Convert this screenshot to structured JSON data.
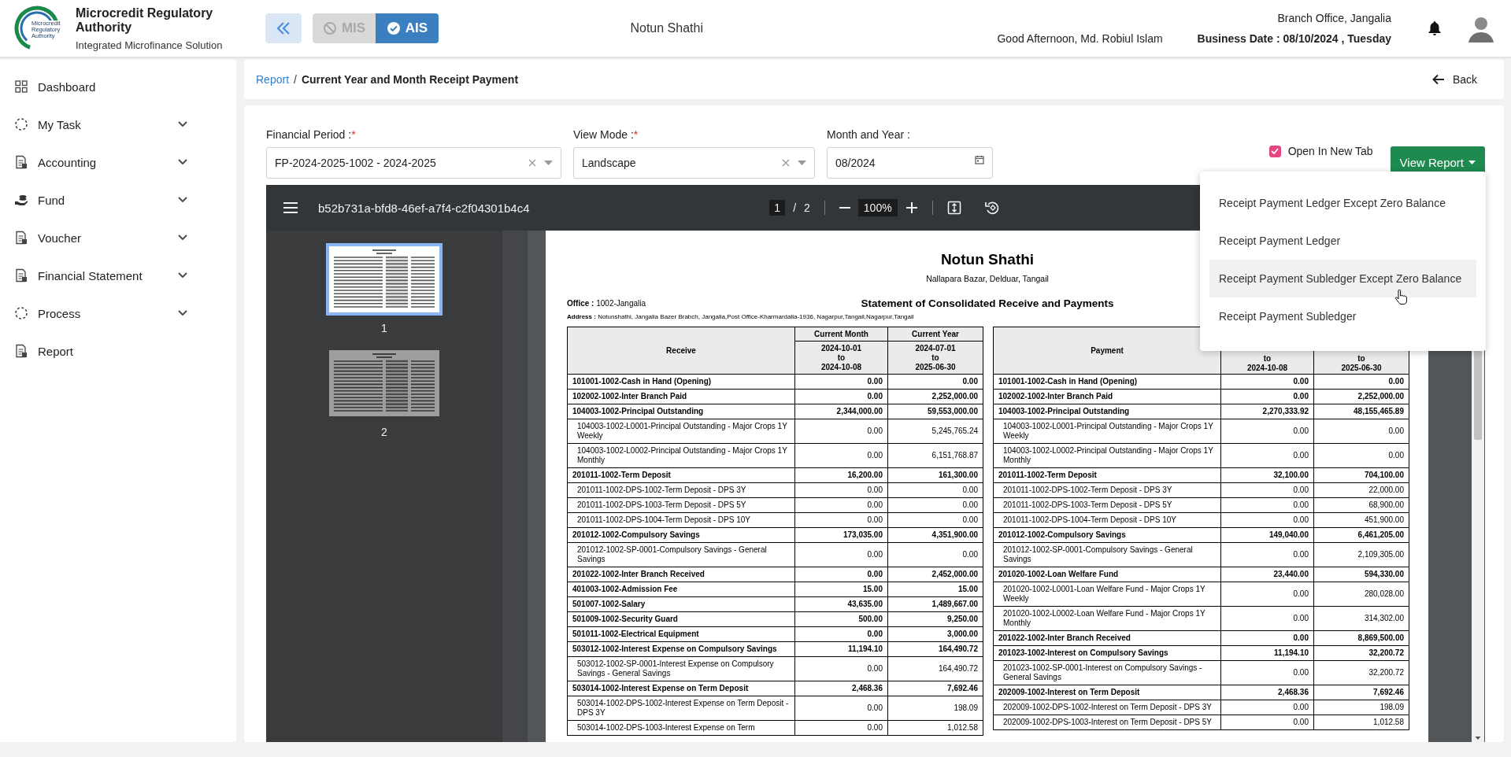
{
  "header": {
    "logo_text": "Microcredit Regulatory Authority",
    "title": "Microcredit Regulatory Authority",
    "subtitle": "Integrated Microfinance Solution",
    "modules": [
      {
        "label": "MIS",
        "selected": false
      },
      {
        "label": "AIS",
        "selected": true
      }
    ],
    "organization": "Notun Shathi",
    "branch": "Branch Office, Jangalia",
    "greeting": "Good Afternoon, Md. Robiul Islam",
    "business_date": "Business Date : 08/10/2024 , Tuesday"
  },
  "sidebar": {
    "items": [
      {
        "label": "Dashboard",
        "expandable": false
      },
      {
        "label": "My Task",
        "expandable": true
      },
      {
        "label": "Accounting",
        "expandable": true
      },
      {
        "label": "Fund",
        "expandable": true
      },
      {
        "label": "Voucher",
        "expandable": true
      },
      {
        "label": "Financial Statement",
        "expandable": true
      },
      {
        "label": "Process",
        "expandable": true
      },
      {
        "label": "Report",
        "expandable": false
      }
    ]
  },
  "breadcrumb": {
    "items": [
      {
        "label": "Report",
        "kind": "link"
      },
      {
        "label": "Current Year and Month Receipt Payment",
        "kind": "current"
      }
    ],
    "separator": "/",
    "back": "Back"
  },
  "form": {
    "fields": [
      {
        "label": "Financial Period :",
        "required_mark": "*",
        "kind": "select",
        "value": "FP-2024-2025-1002 - 2024-2025"
      },
      {
        "label": "View Mode :",
        "required_mark": "*",
        "kind": "select",
        "value": "Landscape"
      },
      {
        "label": "Month and Year :",
        "kind": "month",
        "value": "08/2024"
      }
    ],
    "open_in_new_tab": {
      "label": "Open In New Tab",
      "checked": true
    },
    "view_report": "View Report"
  },
  "report_menu": {
    "items": [
      {
        "label": "Receipt Payment Ledger Except Zero Balance",
        "hovered": false
      },
      {
        "label": "Receipt Payment Ledger",
        "hovered": false
      },
      {
        "label": "Receipt Payment Subledger Except Zero Balance",
        "hovered": true
      },
      {
        "label": "Receipt Payment Subledger",
        "hovered": false
      }
    ]
  },
  "viewer": {
    "file_name": "b52b731a-bfd8-46ef-a7f4-c2f04301b4c4",
    "page": "1",
    "page_separator": "/",
    "page_count": "2",
    "zoom": "100%",
    "thumbnails": [
      {
        "label": "1",
        "selected": true
      },
      {
        "label": "2",
        "selected": false
      }
    ],
    "document": {
      "title": "Notun Shathi",
      "location": "Nallapara Bazar, Delduar, Tangail",
      "office": "**Office :** 1002-Jangalia",
      "statement_title": "Statement of Consolidated Receive and Payments",
      "address": "**Address :** Notunshathi, Jangalia Bazer Brabch, Jangalia,Post Office-Kharmardalla-1936, Nagarpur,Tangail,Nagarpur,Tangail",
      "receive_table": {
        "columns": [
          {
            "heading": "Receive"
          },
          {
            "heading": "Current Month",
            "period": [
              "2024-10-01",
              "to",
              "2024-10-08"
            ]
          },
          {
            "heading": "Current Year",
            "period": [
              "2024-07-01",
              "to",
              "2025-06-30"
            ]
          }
        ],
        "rows": [
          {
            "kind": "account",
            "label": "101001-1002-Cash in Hand (Opening)",
            "month": "0.00",
            "year": "0.00"
          },
          {
            "kind": "account",
            "label": "102002-1002-Inter Branch Paid",
            "month": "0.00",
            "year": "2,252,000.00"
          },
          {
            "kind": "account",
            "label": "104003-1002-Principal Outstanding",
            "month": "2,344,000.00",
            "year": "59,553,000.00"
          },
          {
            "kind": "subaccount",
            "label": "104003-1002-L0001-Principal Outstanding - Major Crops 1Y Weekly",
            "month": "0.00",
            "year": "5,245,765.24"
          },
          {
            "kind": "subaccount",
            "label": "104003-1002-L0002-Principal Outstanding - Major Crops 1Y Monthly",
            "month": "0.00",
            "year": "6,151,768.87"
          },
          {
            "kind": "account",
            "label": "201011-1002-Term Deposit",
            "month": "16,200.00",
            "year": "161,300.00"
          },
          {
            "kind": "subaccount",
            "label": "201011-1002-DPS-1002-Term Deposit - DPS 3Y",
            "month": "0.00",
            "year": "0.00"
          },
          {
            "kind": "subaccount",
            "label": "201011-1002-DPS-1003-Term Deposit - DPS 5Y",
            "month": "0.00",
            "year": "0.00"
          },
          {
            "kind": "subaccount",
            "label": "201011-1002-DPS-1004-Term Deposit - DPS 10Y",
            "month": "0.00",
            "year": "0.00"
          },
          {
            "kind": "account",
            "label": "201012-1002-Compulsory Savings",
            "month": "173,035.00",
            "year": "4,351,900.00"
          },
          {
            "kind": "subaccount",
            "label": "201012-1002-SP-0001-Compulsory Savings - General Savings",
            "month": "0.00",
            "year": "0.00"
          },
          {
            "kind": "account",
            "label": "201022-1002-Inter Branch Received",
            "month": "0.00",
            "year": "2,452,000.00"
          },
          {
            "kind": "account",
            "label": "401003-1002-Admission Fee",
            "month": "15.00",
            "year": "15.00"
          },
          {
            "kind": "account",
            "label": "501007-1002-Salary",
            "month": "43,635.00",
            "year": "1,489,667.00"
          },
          {
            "kind": "account",
            "label": "501009-1002-Security Guard",
            "month": "500.00",
            "year": "9,250.00"
          },
          {
            "kind": "account",
            "label": "501011-1002-Electrical Equipment",
            "month": "0.00",
            "year": "3,000.00"
          },
          {
            "kind": "account",
            "label": "503012-1002-Interest Expense on Compulsory Savings",
            "month": "11,194.10",
            "year": "164,490.72"
          },
          {
            "kind": "subaccount",
            "label": "503012-1002-SP-0001-Interest Expense on Compulsory Savings - General Savings",
            "month": "0.00",
            "year": "164,490.72"
          },
          {
            "kind": "account",
            "label": "503014-1002-Interest Expense on Term Deposit",
            "month": "2,468.36",
            "year": "7,692.46"
          },
          {
            "kind": "subaccount",
            "label": "503014-1002-DPS-1002-Interest Expense on Term Deposit - DPS 3Y",
            "month": "0.00",
            "year": "198.09"
          },
          {
            "kind": "subaccount",
            "label": "503014-1002-DPS-1003-Interest Expense on Term",
            "month": "0.00",
            "year": "1,012.58"
          }
        ]
      },
      "payment_table": {
        "columns": [
          {
            "heading": "Payment"
          },
          {
            "period": [
              "to",
              "2024-10-08"
            ]
          },
          {
            "period": [
              "to",
              "2025-06-30"
            ]
          }
        ],
        "rows": [
          {
            "kind": "account",
            "label": "101001-1002-Cash in Hand (Opening)",
            "month": "0.00",
            "year": "0.00"
          },
          {
            "kind": "account",
            "label": "102002-1002-Inter Branch Paid",
            "month": "0.00",
            "year": "2,252,000.00"
          },
          {
            "kind": "account",
            "label": "104003-1002-Principal Outstanding",
            "month": "2,270,333.92",
            "year": "48,155,465.89"
          },
          {
            "kind": "subaccount",
            "label": "104003-1002-L0001-Principal Outstanding - Major Crops 1Y Weekly",
            "month": "0.00",
            "year": "0.00"
          },
          {
            "kind": "subaccount",
            "label": "104003-1002-L0002-Principal Outstanding - Major Crops 1Y Monthly",
            "month": "0.00",
            "year": "0.00"
          },
          {
            "kind": "account",
            "label": "201011-1002-Term Deposit",
            "month": "32,100.00",
            "year": "704,100.00"
          },
          {
            "kind": "subaccount",
            "label": "201011-1002-DPS-1002-Term Deposit - DPS 3Y",
            "month": "0.00",
            "year": "22,000.00"
          },
          {
            "kind": "subaccount",
            "label": "201011-1002-DPS-1003-Term Deposit - DPS 5Y",
            "month": "0.00",
            "year": "68,900.00"
          },
          {
            "kind": "subaccount",
            "label": "201011-1002-DPS-1004-Term Deposit - DPS 10Y",
            "month": "0.00",
            "year": "451,900.00"
          },
          {
            "kind": "account",
            "label": "201012-1002-Compulsory Savings",
            "month": "149,040.00",
            "year": "6,461,205.00"
          },
          {
            "kind": "subaccount",
            "label": "201012-1002-SP-0001-Compulsory Savings - General Savings",
            "month": "0.00",
            "year": "2,109,305.00"
          },
          {
            "kind": "account",
            "label": "201020-1002-Loan Welfare Fund",
            "month": "23,440.00",
            "year": "594,330.00"
          },
          {
            "kind": "subaccount",
            "label": "201020-1002-L0001-Loan Welfare Fund - Major Crops 1Y Weekly",
            "month": "0.00",
            "year": "280,028.00"
          },
          {
            "kind": "subaccount",
            "label": "201020-1002-L0002-Loan Welfare Fund - Major Crops 1Y Monthly",
            "month": "0.00",
            "year": "314,302.00"
          },
          {
            "kind": "account",
            "label": "201022-1002-Inter Branch Received",
            "month": "0.00",
            "year": "8,869,500.00"
          },
          {
            "kind": "account",
            "label": "201023-1002-Interest on Compulsory Savings",
            "month": "11,194.10",
            "year": "32,200.72"
          },
          {
            "kind": "subaccount",
            "label": "201023-1002-SP-0001-Interest on Compulsory Savings - General Savings",
            "month": "0.00",
            "year": "32,200.72"
          },
          {
            "kind": "account",
            "label": "202009-1002-Interest on Term Deposit",
            "month": "2,468.36",
            "year": "7,692.46"
          },
          {
            "kind": "subaccount",
            "label": "202009-1002-DPS-1002-Interest on Term Deposit - DPS 3Y",
            "month": "0.00",
            "year": "198.09"
          },
          {
            "kind": "subaccount",
            "label": "202009-1002-DPS-1003-Interest on Term Deposit - DPS 5Y",
            "month": "0.00",
            "year": "1,012.58"
          }
        ]
      }
    }
  }
}
